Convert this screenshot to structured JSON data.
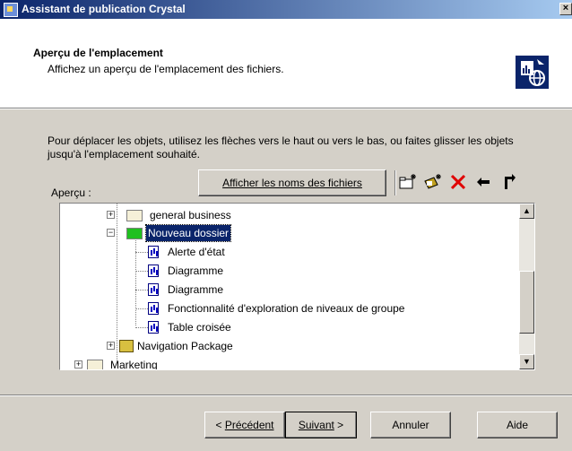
{
  "window": {
    "title": "Assistant de publication Crystal",
    "close_glyph": "×"
  },
  "header": {
    "title": "Aperçu de l'emplacement",
    "subtitle": "Affichez un aperçu de l'emplacement des fichiers."
  },
  "instructions": "Pour déplacer les objets, utilisez les flèches vers le haut ou vers le bas, ou faites glisser les objets jusqu'à l'emplacement souhaité.",
  "apercu_label": "Aperçu :",
  "toolbar": {
    "show_filenames_label": "Afficher les noms des fichiers",
    "icons": [
      "new-folder-icon",
      "new-package-icon",
      "delete-icon",
      "move-up-level-icon",
      "move-down-icon"
    ]
  },
  "tree": {
    "items": [
      {
        "label": "general business",
        "type": "folder"
      },
      {
        "label": "Nouveau dossier",
        "type": "folder-new",
        "selected": true
      },
      {
        "label": "Alerte d'état",
        "type": "report"
      },
      {
        "label": "Diagramme",
        "type": "report"
      },
      {
        "label": "Diagramme",
        "type": "report"
      },
      {
        "label": "Fonctionnalité d'exploration de niveaux de groupe",
        "type": "report"
      },
      {
        "label": "Table croisée",
        "type": "report"
      },
      {
        "label": "Navigation Package",
        "type": "package"
      },
      {
        "label": "Marketing",
        "type": "folder"
      }
    ]
  },
  "footer": {
    "prev_label": "Précédent",
    "next_label": "Suivant",
    "cancel_label": "Annuler",
    "help_label": "Aide"
  }
}
